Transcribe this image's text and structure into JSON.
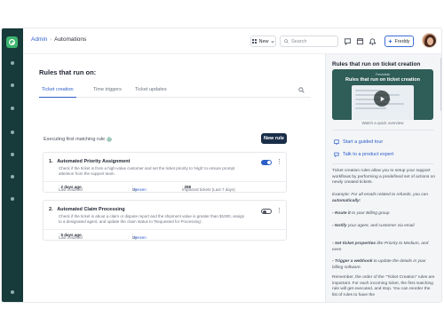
{
  "breadcrumb": {
    "admin": "Admin",
    "separator": "›",
    "current": "Automations"
  },
  "topbar": {
    "new_label": "New",
    "search_placeholder": "Search",
    "freddy_label": "Freddy",
    "icons": [
      "chat-icon",
      "calendar-icon",
      "bell-icon",
      "grid-icon"
    ]
  },
  "main": {
    "title": "Rules that run on:",
    "tabs": [
      {
        "label": "Ticket creation",
        "active": true
      },
      {
        "label": "Time triggers",
        "active": false
      },
      {
        "label": "Ticket updates",
        "active": false
      }
    ],
    "executing_label": "Executing first matching rule",
    "new_rule_label": "New rule",
    "rules": [
      {
        "number": "1.",
        "title": "Automated Priority Assignment",
        "description": "Check if the ticket is from a high-value customer and set the ticket priority to 'High' to ensure prompt attention from the support team.",
        "enabled": true,
        "modified_label": "Last modified",
        "modified_value": "2 days ago",
        "by_label": "By",
        "by_value": "Jensen",
        "impacted_label": "Impacted tickets (Last 7 days)",
        "impacted_value": "258"
      },
      {
        "number": "2.",
        "title": "Automated Claim Processing",
        "description": "Check if the ticket is about a claim or dispute report and the shipment value is greater than $1000, assign to a designated agent, and update the claim status to 'Requested for Processing'.",
        "enabled": false,
        "modified_label": "Last modified",
        "modified_value": "5 days ago",
        "by_label": "By",
        "by_value": "Jensen"
      }
    ]
  },
  "panel": {
    "title": "Rules that run on ticket creation",
    "video_small": "Freshdesk",
    "video_title": "Rules that run on ticket creation",
    "video_caption": "Watch a quick overview",
    "links": [
      "Start a guided tour",
      "Talk to a product expert"
    ],
    "intro": "Ticket creation rules allow you to setup your support workflows by performing a predefined set of actions on newly created tickets.",
    "example_lead": "Example: For all emails related to refunds, you can",
    "example_emph": "automatically:",
    "bullets": [
      {
        "lead": "- Route it",
        "rest": "to your Billing group"
      },
      {
        "lead": "- Notify",
        "rest": "your agent, and customer via email"
      },
      {
        "lead": "- Set ticket properties",
        "rest": "like Priority to Medium, and even"
      },
      {
        "lead": "- Trigger a webhook",
        "rest": "to update the details in your billing software."
      }
    ],
    "outro": "Remember, the order of the \"Ticket Creation\" rules are important. For each incoming ticket, the first matching rule will get executed, and stop. You can reorder the list of rules to have the"
  },
  "colors": {
    "rail": "#173a3a",
    "accent": "#2d5ec9",
    "primary_button": "#1a2e48",
    "brand": "#3cb46e"
  }
}
